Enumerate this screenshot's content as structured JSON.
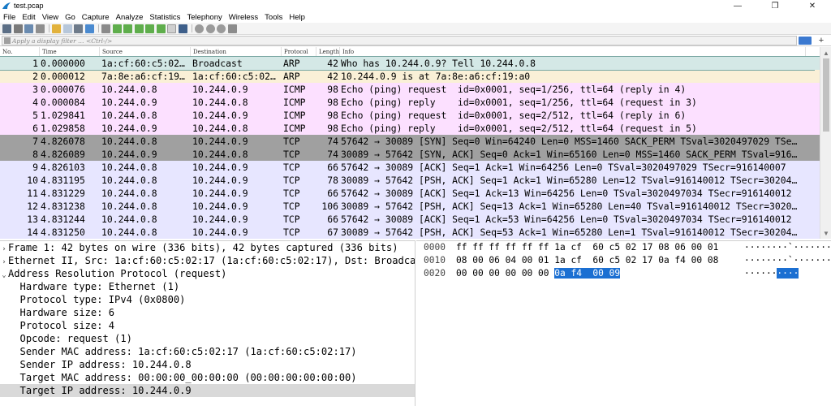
{
  "window": {
    "title": "test.pcap",
    "min_glyph": "—",
    "max_glyph": "❐",
    "close_glyph": "✕"
  },
  "menu": [
    "File",
    "Edit",
    "View",
    "Go",
    "Capture",
    "Analyze",
    "Statistics",
    "Telephony",
    "Wireless",
    "Tools",
    "Help"
  ],
  "filter": {
    "placeholder": "Apply a display filter … <Ctrl-/>",
    "plus": "+"
  },
  "packet_list": {
    "headers": [
      "No.",
      "Time",
      "Source",
      "Destination",
      "Protocol",
      "Length",
      "Info"
    ],
    "rows": [
      {
        "no": "1",
        "time": "0.000000",
        "src": "1a:cf:60:c5:02…",
        "dst": "Broadcast",
        "proto": "ARP",
        "len": "42",
        "info": "Who has 10.244.0.9? Tell 10.244.0.8",
        "bg": "#d4e8e6",
        "selected": true
      },
      {
        "no": "2",
        "time": "0.000012",
        "src": "7a:8e:a6:cf:19…",
        "dst": "1a:cf:60:c5:02…",
        "proto": "ARP",
        "len": "42",
        "info": "10.244.0.9 is at 7a:8e:a6:cf:19:a0",
        "bg": "#faf0d7"
      },
      {
        "no": "3",
        "time": "0.000076",
        "src": "10.244.0.8",
        "dst": "10.244.0.9",
        "proto": "ICMP",
        "len": "98",
        "info": "Echo (ping) request  id=0x0001, seq=1/256, ttl=64 (reply in 4)",
        "bg": "#fce0ff"
      },
      {
        "no": "4",
        "time": "0.000084",
        "src": "10.244.0.9",
        "dst": "10.244.0.8",
        "proto": "ICMP",
        "len": "98",
        "info": "Echo (ping) reply    id=0x0001, seq=1/256, ttl=64 (request in 3)",
        "bg": "#fce0ff"
      },
      {
        "no": "5",
        "time": "1.029841",
        "src": "10.244.0.8",
        "dst": "10.244.0.9",
        "proto": "ICMP",
        "len": "98",
        "info": "Echo (ping) request  id=0x0001, seq=2/512, ttl=64 (reply in 6)",
        "bg": "#fce0ff"
      },
      {
        "no": "6",
        "time": "1.029858",
        "src": "10.244.0.9",
        "dst": "10.244.0.8",
        "proto": "ICMP",
        "len": "98",
        "info": "Echo (ping) reply    id=0x0001, seq=2/512, ttl=64 (request in 5)",
        "bg": "#fce0ff"
      },
      {
        "no": "7",
        "time": "4.826078",
        "src": "10.244.0.8",
        "dst": "10.244.0.9",
        "proto": "TCP",
        "len": "74",
        "info": "57642 → 30089 [SYN] Seq=0 Win=64240 Len=0 MSS=1460 SACK_PERM TSval=3020497029 TSe…",
        "bg": "#a0a0a0"
      },
      {
        "no": "8",
        "time": "4.826089",
        "src": "10.244.0.9",
        "dst": "10.244.0.8",
        "proto": "TCP",
        "len": "74",
        "info": "30089 → 57642 [SYN, ACK] Seq=0 Ack=1 Win=65160 Len=0 MSS=1460 SACK_PERM TSval=916…",
        "bg": "#a0a0a0"
      },
      {
        "no": "9",
        "time": "4.826103",
        "src": "10.244.0.8",
        "dst": "10.244.0.9",
        "proto": "TCP",
        "len": "66",
        "info": "57642 → 30089 [ACK] Seq=1 Ack=1 Win=64256 Len=0 TSval=3020497029 TSecr=916140007",
        "bg": "#e7e6ff"
      },
      {
        "no": "10",
        "time": "4.831195",
        "src": "10.244.0.8",
        "dst": "10.244.0.9",
        "proto": "TCP",
        "len": "78",
        "info": "30089 → 57642 [PSH, ACK] Seq=1 Ack=1 Win=65280 Len=12 TSval=916140012 TSecr=30204…",
        "bg": "#e7e6ff"
      },
      {
        "no": "11",
        "time": "4.831229",
        "src": "10.244.0.8",
        "dst": "10.244.0.9",
        "proto": "TCP",
        "len": "66",
        "info": "57642 → 30089 [ACK] Seq=1 Ack=13 Win=64256 Len=0 TSval=3020497034 TSecr=916140012",
        "bg": "#e7e6ff"
      },
      {
        "no": "12",
        "time": "4.831238",
        "src": "10.244.0.8",
        "dst": "10.244.0.9",
        "proto": "TCP",
        "len": "106",
        "info": "30089 → 57642 [PSH, ACK] Seq=13 Ack=1 Win=65280 Len=40 TSval=916140012 TSecr=3020…",
        "bg": "#e7e6ff"
      },
      {
        "no": "13",
        "time": "4.831244",
        "src": "10.244.0.8",
        "dst": "10.244.0.9",
        "proto": "TCP",
        "len": "66",
        "info": "57642 → 30089 [ACK] Seq=1 Ack=53 Win=64256 Len=0 TSval=3020497034 TSecr=916140012",
        "bg": "#e7e6ff"
      },
      {
        "no": "14",
        "time": "4.831250",
        "src": "10.244.0.8",
        "dst": "10.244.0.9",
        "proto": "TCP",
        "len": "67",
        "info": "30089 → 57642 [PSH, ACK] Seq=53 Ack=1 Win=65280 Len=1 TSval=916140012 TSecr=30204…",
        "bg": "#e7e6ff"
      }
    ]
  },
  "details": [
    {
      "arrow": "›",
      "text": "Frame 1: 42 bytes on wire (336 bits), 42 bytes captured (336 bits)"
    },
    {
      "arrow": "›",
      "text": "Ethernet II, Src: 1a:cf:60:c5:02:17 (1a:cf:60:c5:02:17), Dst: Broadcast (ff:ff:ff:ff:ff:ff)"
    },
    {
      "arrow": "⌄",
      "text": "Address Resolution Protocol (request)"
    },
    {
      "arrow": "",
      "text": "  Hardware type: Ethernet (1)"
    },
    {
      "arrow": "",
      "text": "  Protocol type: IPv4 (0x0800)"
    },
    {
      "arrow": "",
      "text": "  Hardware size: 6"
    },
    {
      "arrow": "",
      "text": "  Protocol size: 4"
    },
    {
      "arrow": "",
      "text": "  Opcode: request (1)"
    },
    {
      "arrow": "",
      "text": "  Sender MAC address: 1a:cf:60:c5:02:17 (1a:cf:60:c5:02:17)"
    },
    {
      "arrow": "",
      "text": "  Sender IP address: 10.244.0.8"
    },
    {
      "arrow": "",
      "text": "  Target MAC address: 00:00:00_00:00:00 (00:00:00:00:00:00)"
    },
    {
      "arrow": "",
      "text": "  Target IP address: 10.244.0.9",
      "selected": true
    }
  ],
  "bytes": [
    {
      "offset": "0000",
      "hex": "ff ff ff ff ff ff 1a cf  60 c5 02 17 08 06 00 01",
      "hex_hl": "",
      "ascii": "········`·······",
      "ascii_hl": ""
    },
    {
      "offset": "0010",
      "hex": "08 00 06 04 00 01 1a cf  60 c5 02 17 0a f4 00 08",
      "hex_hl": "",
      "ascii": "········`·······",
      "ascii_hl": ""
    },
    {
      "offset": "0020",
      "hex": "00 00 00 00 00 00 ",
      "hex_hl": "0a f4  00 09",
      "ascii": "······",
      "ascii_hl": "····"
    }
  ],
  "colors": {
    "selected_row": "#d4e8e6",
    "hex_highlight": "#1b6fd2",
    "arp_reply": "#faf0d7",
    "icmp": "#fce0ff",
    "tcp_syn": "#a0a0a0",
    "tcp": "#e7e6ff"
  }
}
